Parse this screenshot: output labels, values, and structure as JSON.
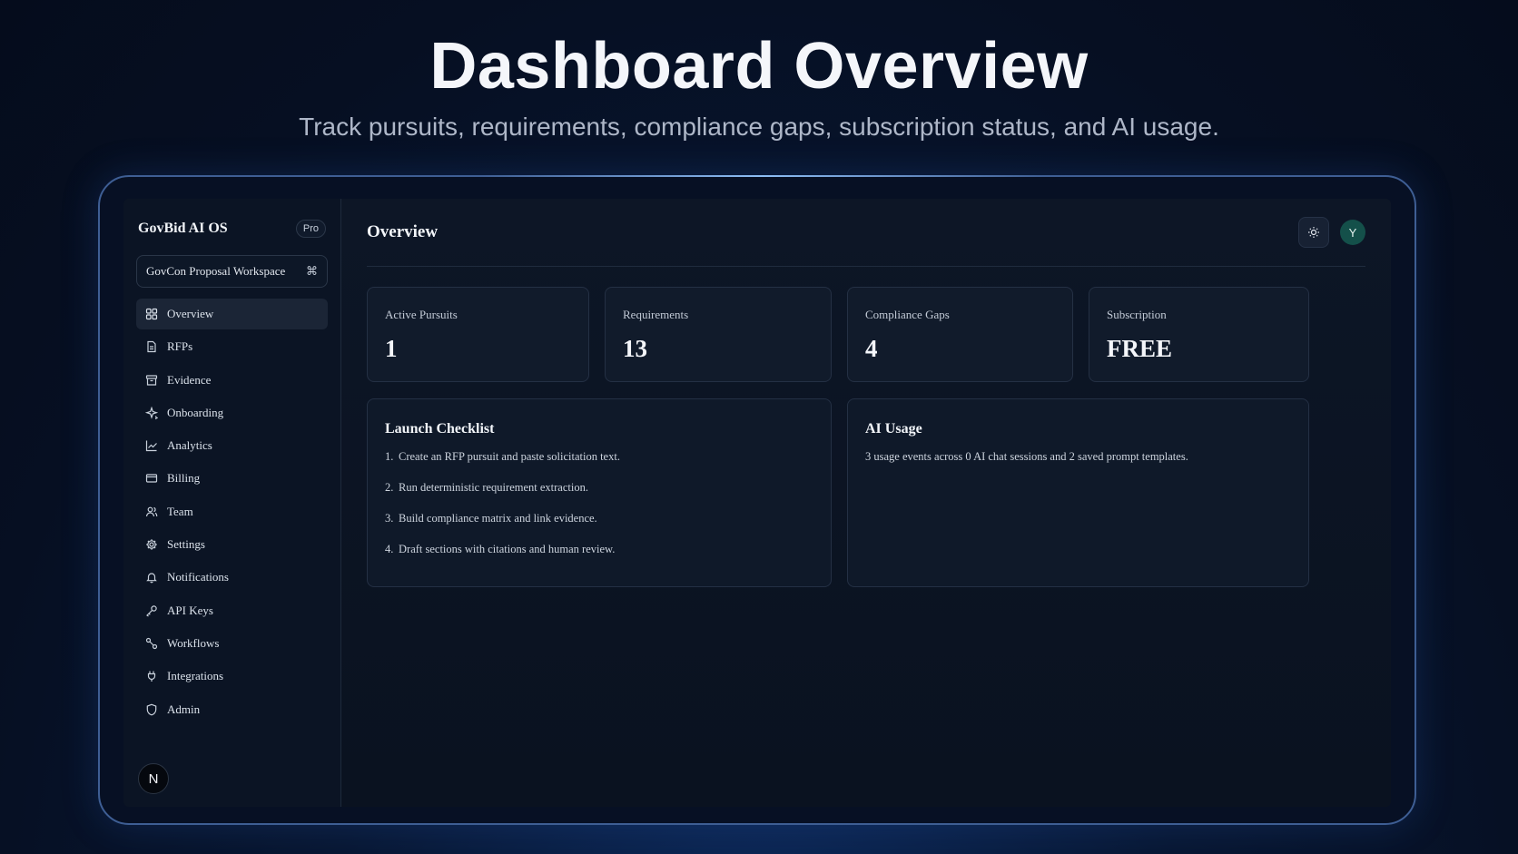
{
  "hero": {
    "title": "Dashboard Overview",
    "subtitle": "Track pursuits, requirements, compliance gaps, subscription status, and AI usage."
  },
  "sidebar": {
    "brand": "GovBid AI OS",
    "plan_badge": "Pro",
    "workspace": {
      "label": "GovCon Proposal Workspace",
      "shortcut_icon": "command-icon",
      "shortcut_glyph": "⌘"
    },
    "items": [
      {
        "label": "Overview",
        "icon": "grid-icon",
        "active": true
      },
      {
        "label": "RFPs",
        "icon": "file-icon"
      },
      {
        "label": "Evidence",
        "icon": "archive-icon"
      },
      {
        "label": "Onboarding",
        "icon": "sparkle-icon"
      },
      {
        "label": "Analytics",
        "icon": "chart-icon"
      },
      {
        "label": "Billing",
        "icon": "credit-card-icon"
      },
      {
        "label": "Team",
        "icon": "users-icon"
      },
      {
        "label": "Settings",
        "icon": "gear-icon"
      },
      {
        "label": "Notifications",
        "icon": "bell-icon"
      },
      {
        "label": "API Keys",
        "icon": "key-icon"
      },
      {
        "label": "Workflows",
        "icon": "workflow-icon"
      },
      {
        "label": "Integrations",
        "icon": "plug-icon"
      },
      {
        "label": "Admin",
        "icon": "shield-icon"
      }
    ],
    "user_initial": "N"
  },
  "header": {
    "title": "Overview",
    "theme_toggle_icon": "sun-icon",
    "avatar_initial": "Y"
  },
  "stats": [
    {
      "label": "Active Pursuits",
      "value": "1"
    },
    {
      "label": "Requirements",
      "value": "13"
    },
    {
      "label": "Compliance Gaps",
      "value": "4"
    },
    {
      "label": "Subscription",
      "value": "FREE"
    }
  ],
  "checklist": {
    "title": "Launch Checklist",
    "items": [
      {
        "num": "1.",
        "text": "Create an RFP pursuit and paste solicitation text."
      },
      {
        "num": "2.",
        "text": "Run deterministic requirement extraction."
      },
      {
        "num": "3.",
        "text": "Build compliance matrix and link evidence."
      },
      {
        "num": "4.",
        "text": "Draft sections with citations and human review."
      }
    ]
  },
  "ai_usage": {
    "title": "AI Usage",
    "text": "3 usage events across 0 AI chat sessions and 2 saved prompt templates."
  },
  "colors": {
    "background": "#060f22",
    "frame_border": "#3e5e94",
    "avatar_teal": "#14504a",
    "card_bg": "#111b2b"
  }
}
